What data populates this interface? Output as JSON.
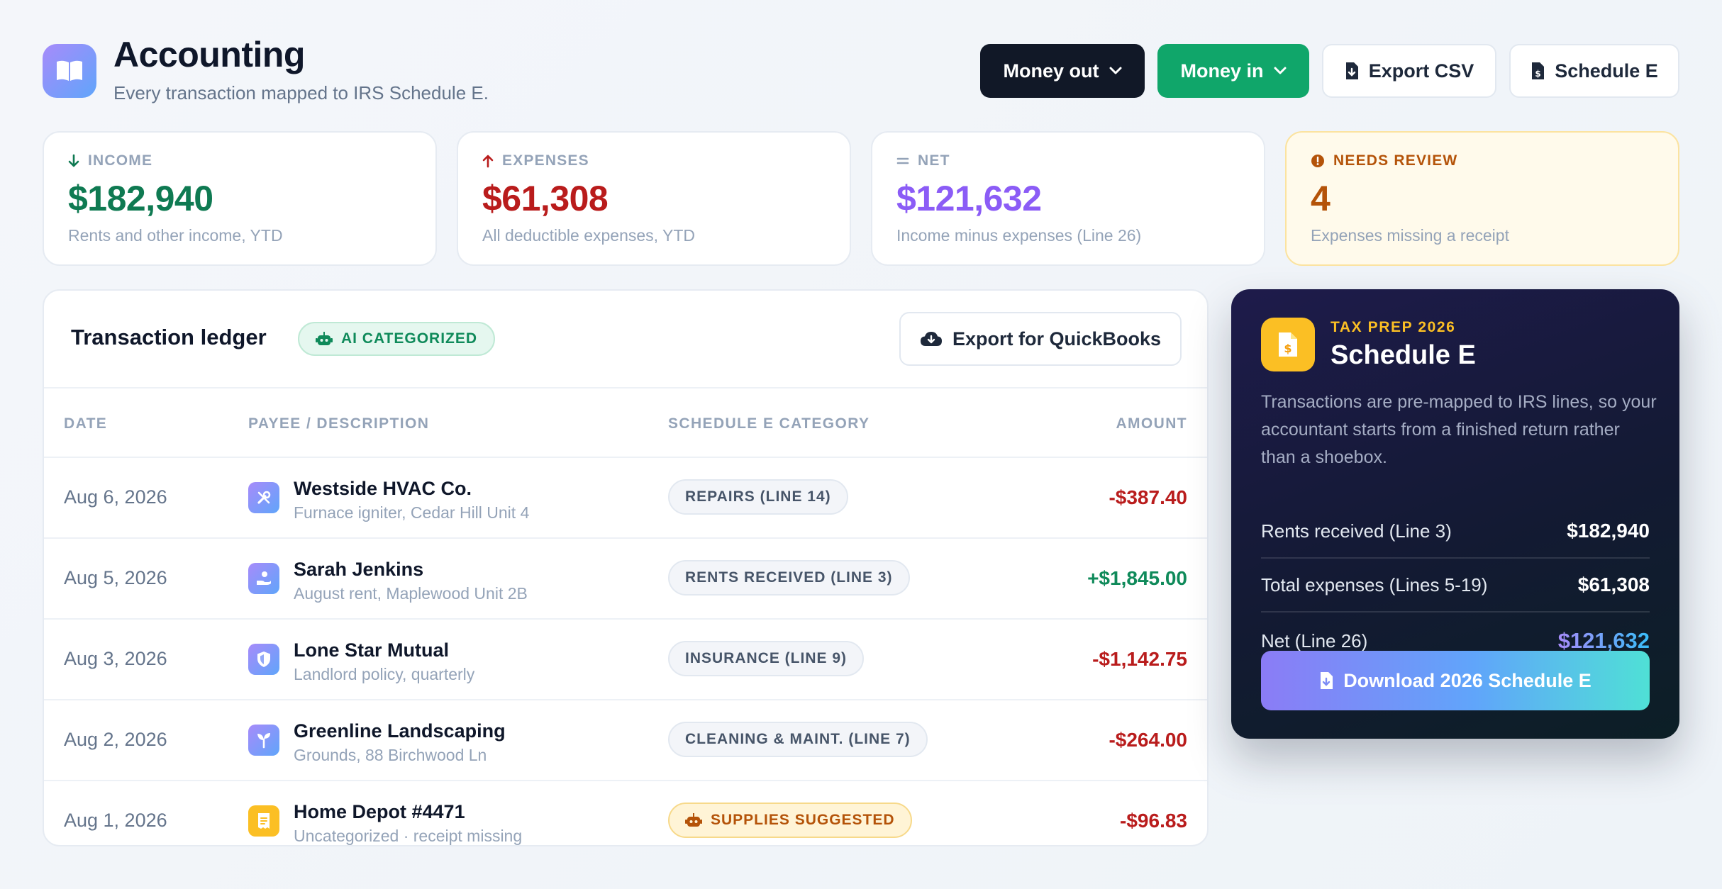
{
  "header": {
    "title": "Accounting",
    "subtitle": "Every transaction mapped to IRS Schedule E.",
    "buttons": {
      "money_out": "Money out",
      "money_in": "Money in",
      "export_csv": "Export CSV",
      "schedule_e": "Schedule E"
    }
  },
  "stats": [
    {
      "label": "INCOME",
      "value": "$182,940",
      "desc": "Rents and other income, YTD",
      "color": "#0f7a52",
      "icon": "arrow-down-icon"
    },
    {
      "label": "EXPENSES",
      "value": "$61,308",
      "desc": "All deductible expenses, YTD",
      "color": "#b91c1c",
      "icon": "arrow-up-icon"
    },
    {
      "label": "NET",
      "value": "$121,632",
      "desc": "Income minus expenses (Line 26)",
      "color": "#8b5cf6",
      "icon": "equals-icon"
    },
    {
      "label": "NEEDS REVIEW",
      "value": "4",
      "desc": "Expenses missing a receipt",
      "color": "#b45309",
      "icon": "alert-icon"
    }
  ],
  "ledger": {
    "title": "Transaction ledger",
    "badge": "AI CATEGORIZED",
    "export_button": "Export for QuickBooks",
    "columns": [
      "DATE",
      "PAYEE / DESCRIPTION",
      "SCHEDULE E CATEGORY",
      "AMOUNT"
    ],
    "rows": [
      {
        "date": "Aug 6, 2026",
        "payee": "Westside HVAC Co.",
        "desc": "Furnace igniter, Cedar Hill Unit 4",
        "category": "REPAIRS (LINE 14)",
        "amount": "-$387.40",
        "icon": "wrench-icon"
      },
      {
        "date": "Aug 5, 2026",
        "payee": "Sarah Jenkins",
        "desc": "August rent, Maplewood Unit 2B",
        "category": "RENTS RECEIVED (LINE 3)",
        "amount": "+$1,845.00",
        "icon": "hand-coin-icon"
      },
      {
        "date": "Aug 3, 2026",
        "payee": "Lone Star Mutual",
        "desc": "Landlord policy, quarterly",
        "category": "INSURANCE (LINE 9)",
        "amount": "-$1,142.75",
        "icon": "shield-icon"
      },
      {
        "date": "Aug 2, 2026",
        "payee": "Greenline Landscaping",
        "desc": "Grounds, 88 Birchwood Ln",
        "category": "CLEANING & MAINT. (LINE 7)",
        "amount": "-$264.00",
        "icon": "seedling-icon"
      },
      {
        "date": "Aug 1, 2026",
        "payee": "Home Depot #4471",
        "desc": "Uncategorized · receipt missing",
        "category": "SUPPLIES SUGGESTED",
        "amount": "-$96.83",
        "icon": "receipt-icon"
      }
    ]
  },
  "tax_panel": {
    "eyebrow": "TAX PREP 2026",
    "title": "Schedule E",
    "body": "Transactions are pre-mapped to IRS lines, so your accountant starts from a finished return rather than a shoebox.",
    "rows": [
      {
        "label": "Rents received (Line 3)",
        "value": "$182,940"
      },
      {
        "label": "Total expenses (Lines 5-19)",
        "value": "$61,308"
      },
      {
        "label": "Net (Line 26)",
        "value": "$121,632"
      }
    ],
    "download_button": "Download 2026 Schedule E"
  },
  "colors": {
    "accent_purple": "#8b5cf6",
    "success_green": "#10a66a",
    "danger_red": "#b91c1c",
    "warning_amber": "#fbbf24"
  }
}
